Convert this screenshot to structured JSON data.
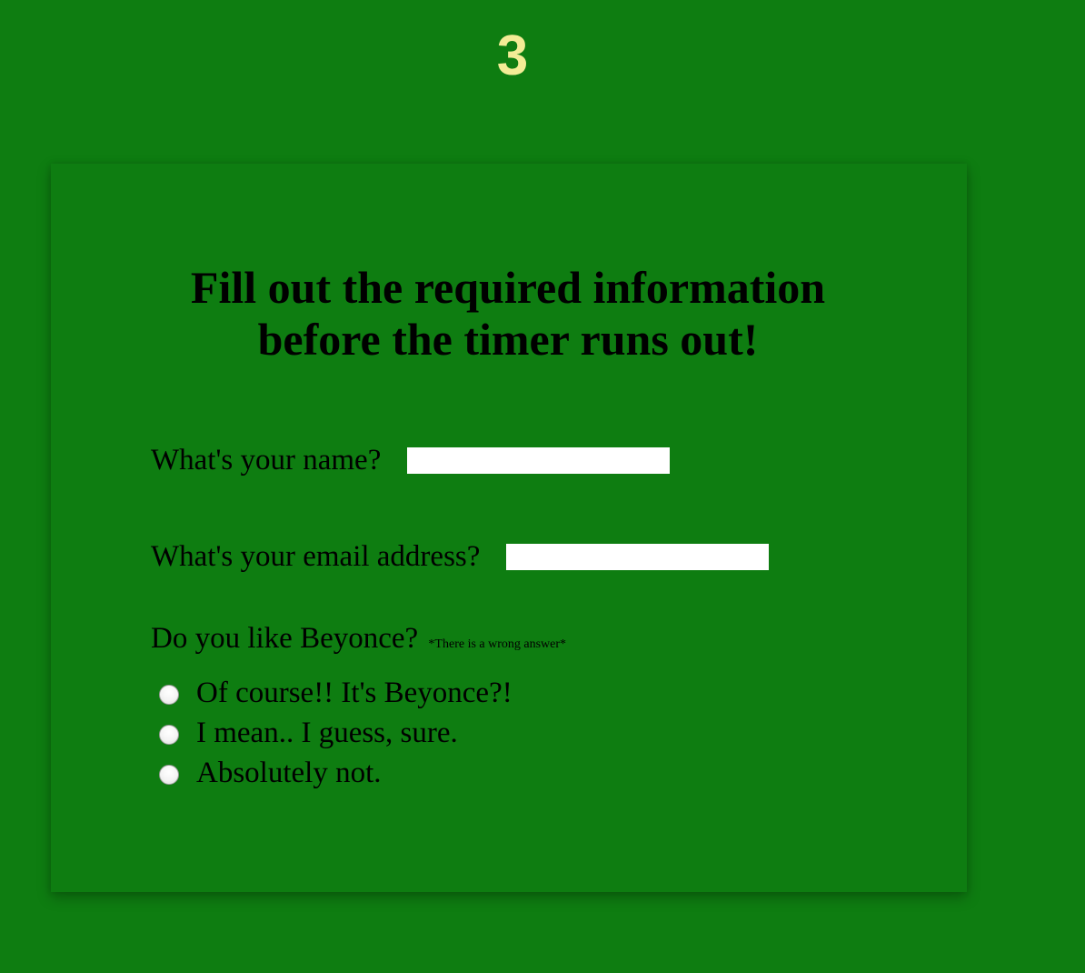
{
  "timer": {
    "value": "3"
  },
  "form": {
    "heading_line1": "Fill out the required information",
    "heading_line2": "before the timer runs out!",
    "name_label": "What's your name?",
    "name_value": "",
    "email_label": "What's your email address?",
    "email_value": "",
    "beyonce_question": "Do you like Beyonce?",
    "beyonce_note": "*There is a wrong answer*",
    "options": [
      {
        "label": "Of course!! It's Beyonce?!",
        "selected": false
      },
      {
        "label": "I mean.. I guess, sure.",
        "selected": false
      },
      {
        "label": "Absolutely not.",
        "selected": false
      }
    ]
  },
  "colors": {
    "background": "#0e7d11",
    "timer_text": "#f3ec96",
    "input_background": "#ffffff"
  }
}
